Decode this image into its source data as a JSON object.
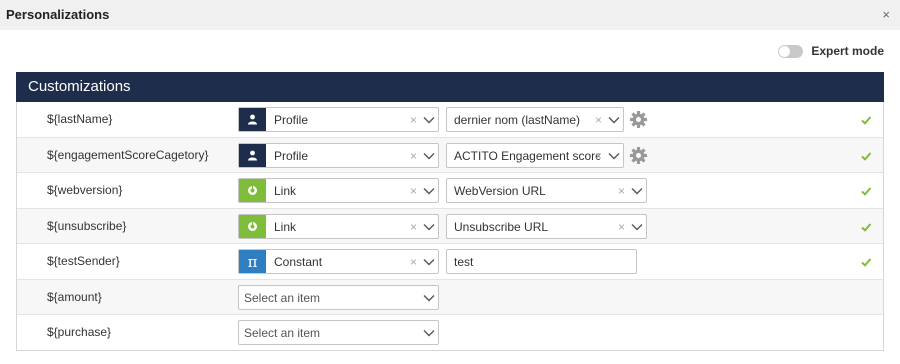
{
  "dialog": {
    "title": "Personalizations",
    "close": "×"
  },
  "expert_mode": {
    "label": "Expert mode",
    "enabled": false
  },
  "panel": {
    "title": "Customizations"
  },
  "rows": [
    {
      "variable": "${lastName}",
      "type_icon": "person-icon",
      "type": "Profile",
      "value": "dernier nom (lastName)",
      "has_gear": true,
      "valid": true
    },
    {
      "variable": "${engagementScoreCagetory}",
      "type_icon": "person-icon",
      "type": "Profile",
      "value": "ACTITO Engagement score",
      "has_gear": true,
      "valid": true
    },
    {
      "variable": "${webversion}",
      "type_icon": "link-icon",
      "type": "Link",
      "value": "WebVersion URL",
      "has_gear": false,
      "valid": true
    },
    {
      "variable": "${unsubscribe}",
      "type_icon": "link-icon",
      "type": "Link",
      "value": "Unsubscribe URL",
      "has_gear": false,
      "valid": true
    },
    {
      "variable": "${testSender}",
      "type_icon": "pi-icon",
      "type": "Constant",
      "value": "test",
      "has_gear": false,
      "valid": true
    },
    {
      "variable": "${amount}",
      "placeholder": "Select an item"
    },
    {
      "variable": "${purchase}",
      "placeholder": "Select an item"
    }
  ],
  "colors": {
    "header_bg": "#1f2d4c",
    "profile_icon_bg": "#1f2d4c",
    "link_icon_bg": "#7dbd3a",
    "constant_icon_bg": "#2f7fc0",
    "check": "#7dbd3a"
  }
}
